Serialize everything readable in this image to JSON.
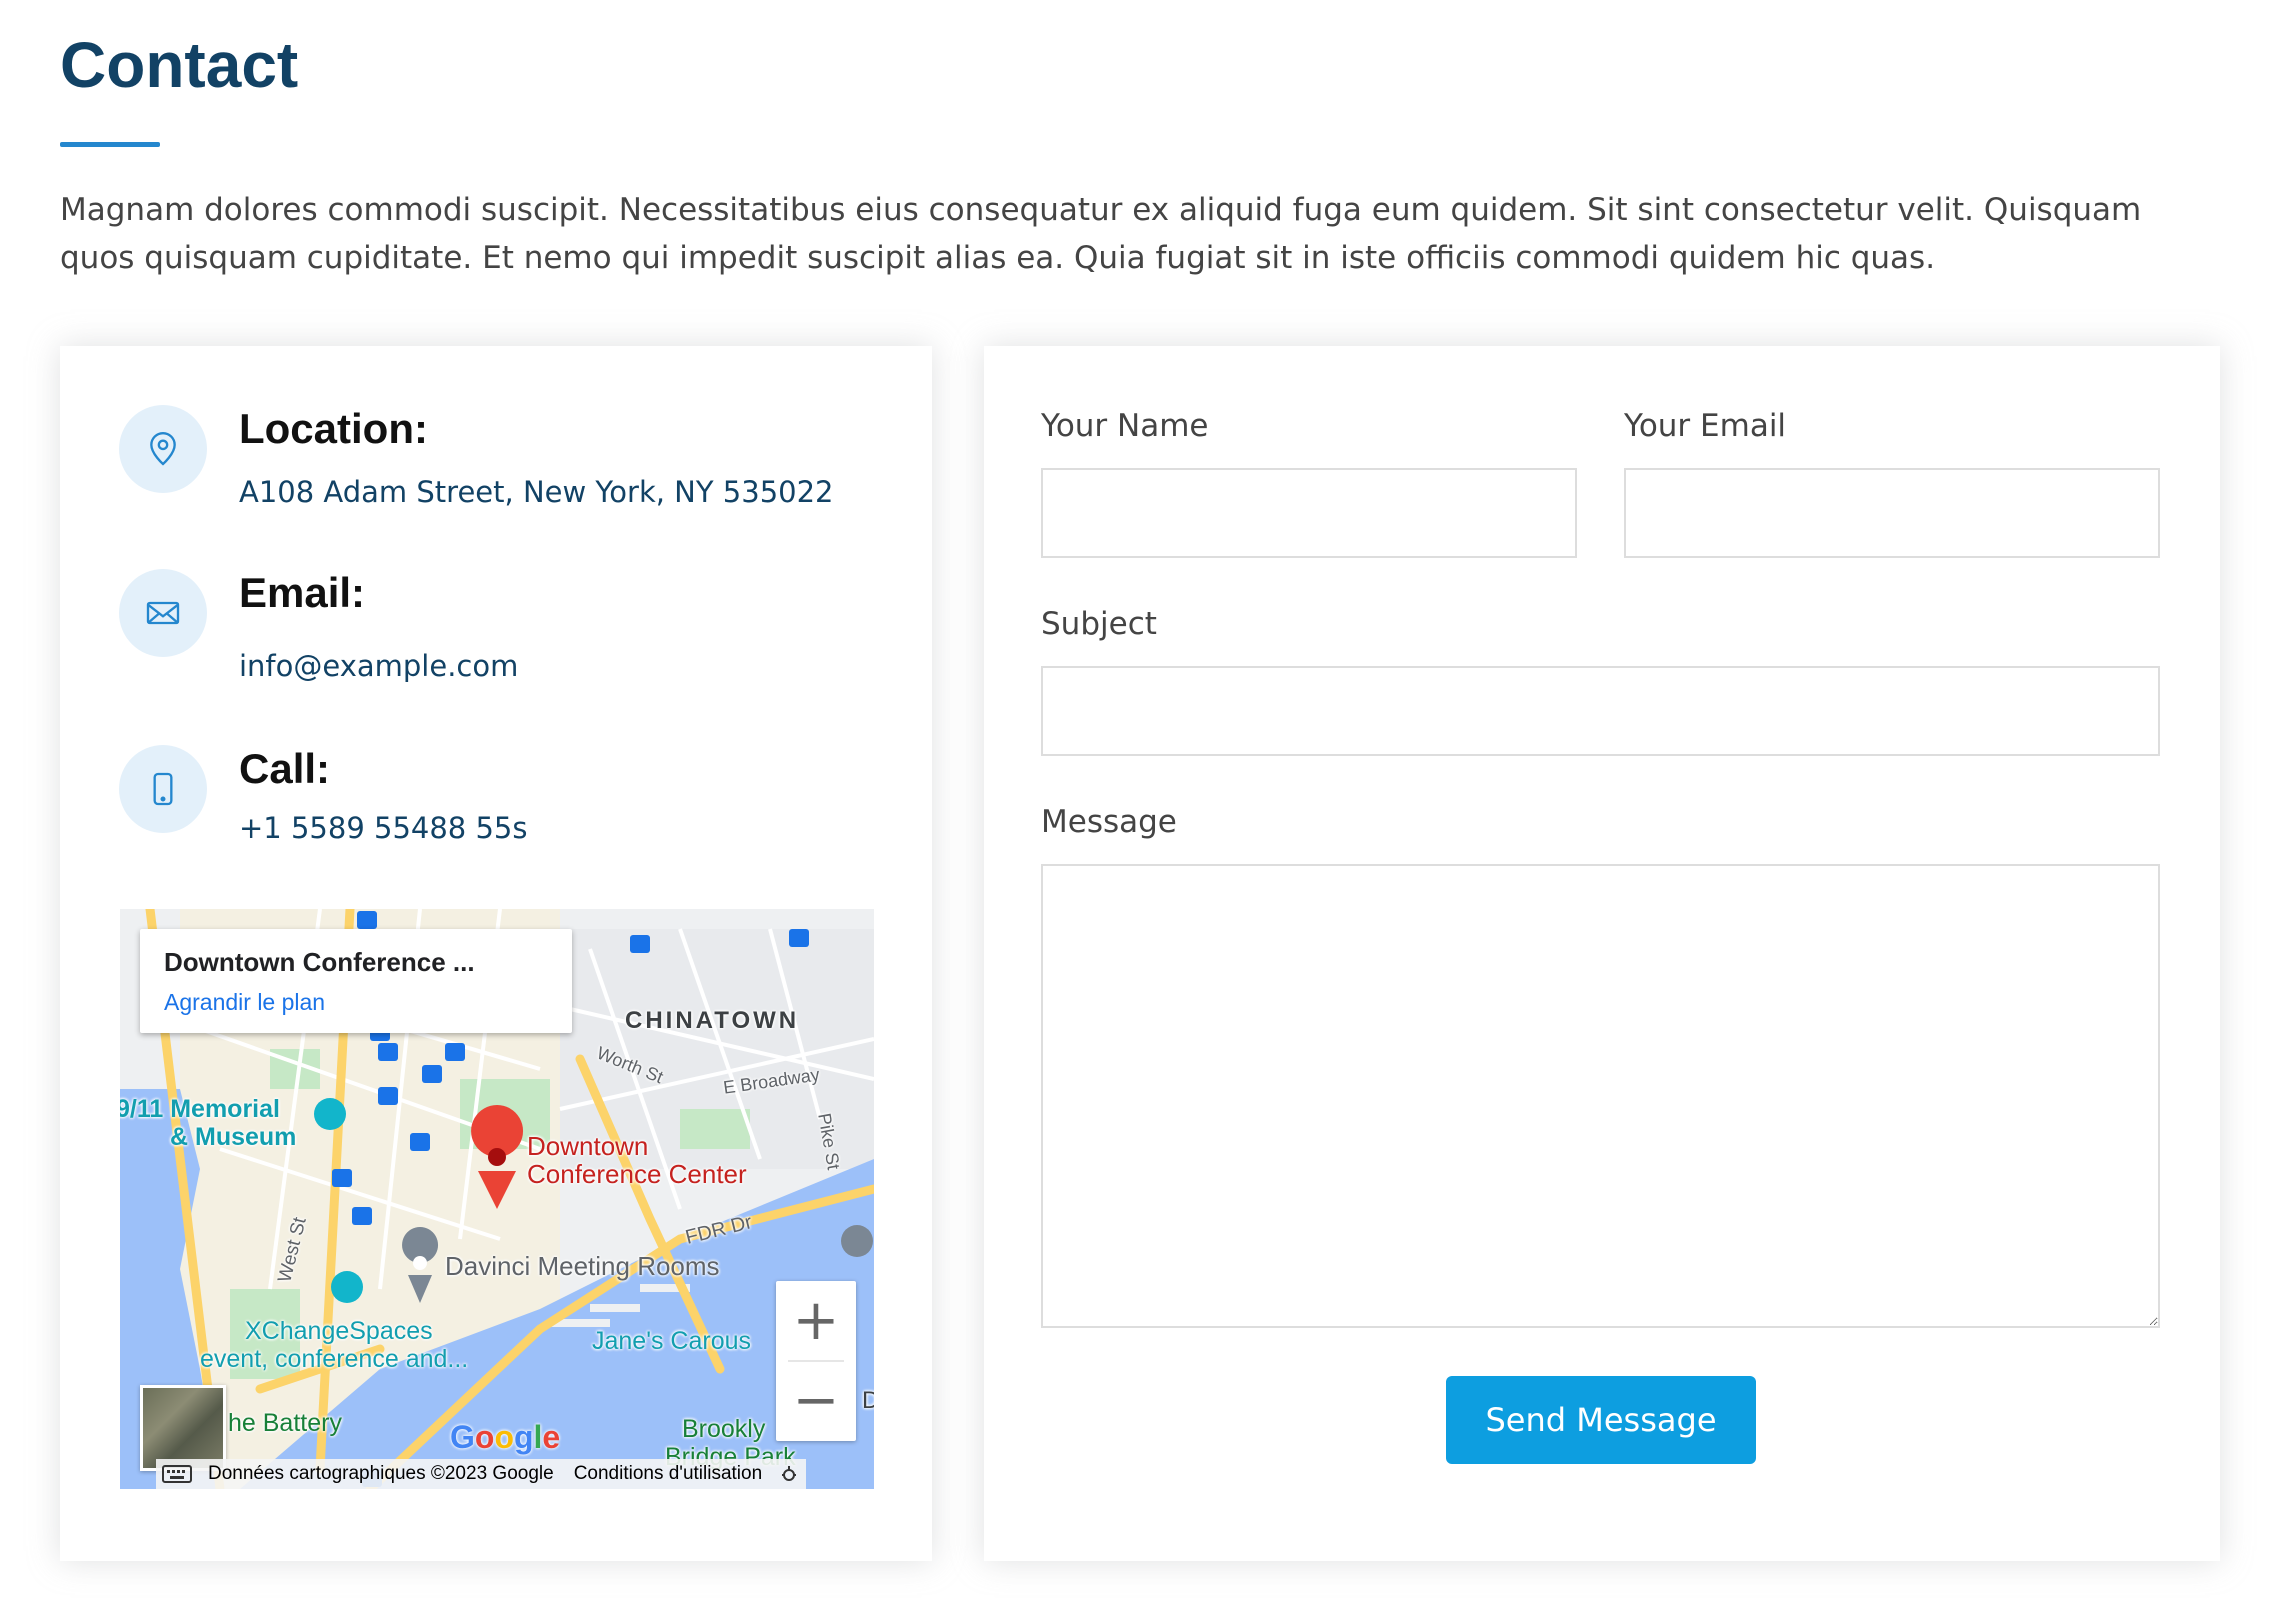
{
  "section": {
    "title": "Contact",
    "intro": "Magnam dolores commodi suscipit. Necessitatibus eius consequatur ex aliquid fuga eum quidem. Sit sint consectetur velit. Quisquam quos quisquam cupiditate. Et nemo qui impedit suscipit alias ea. Quia fugiat sit in iste officiis commodi quidem hic quas."
  },
  "info": {
    "location": {
      "title": "Location:",
      "value": "A108 Adam Street, New York, NY 535022",
      "icon": "map-pin-icon"
    },
    "email": {
      "title": "Email:",
      "value": "info@example.com",
      "icon": "envelope-icon"
    },
    "call": {
      "title": "Call:",
      "value": "+1 5589 55488 55s",
      "icon": "phone-icon"
    }
  },
  "map": {
    "popup_title": "Downtown Conference ...",
    "popup_link": "Agrandir le plan",
    "labels": {
      "chinatown": "CHINATOWN",
      "worth_st": "Worth St",
      "e_broadway": "E Broadway",
      "pike_st": "Pike St",
      "memorial_1": "9/11 Memorial",
      "memorial_2": "& Museum",
      "downtown_1": "Downtown",
      "downtown_2": "Conference Center",
      "fdr": "FDR Dr",
      "davinci": "Davinci Meeting Rooms",
      "west_st": "West St",
      "xchange_1": "XChangeSpaces",
      "xchange_2": "event, conference and...",
      "janes": "Jane's Carous",
      "battery": "he Battery",
      "brooklyn_1": "Brookly",
      "brooklyn_2": "Bridge Park",
      "edge_d": "D"
    },
    "google": "Google",
    "zoom_in": "+",
    "zoom_out": "−",
    "footer_data": "Données cartographiques ©2023 Google",
    "footer_terms": "Conditions d'utilisation",
    "colors": {
      "water": "#9cc0f9",
      "land": "#f1f3f4",
      "road": "#fcd36a",
      "park": "#c6e8c6",
      "pin": "#ea4335"
    }
  },
  "form": {
    "name_label": "Your Name",
    "email_label": "Your Email",
    "subject_label": "Subject",
    "message_label": "Message",
    "name_value": "",
    "email_value": "",
    "subject_value": "",
    "message_value": "",
    "submit_label": "Send Message"
  },
  "colors": {
    "heading": "#124265",
    "accent": "#2487ce",
    "button": "#0d9ee0",
    "icon_bg": "#e3f0fa"
  }
}
